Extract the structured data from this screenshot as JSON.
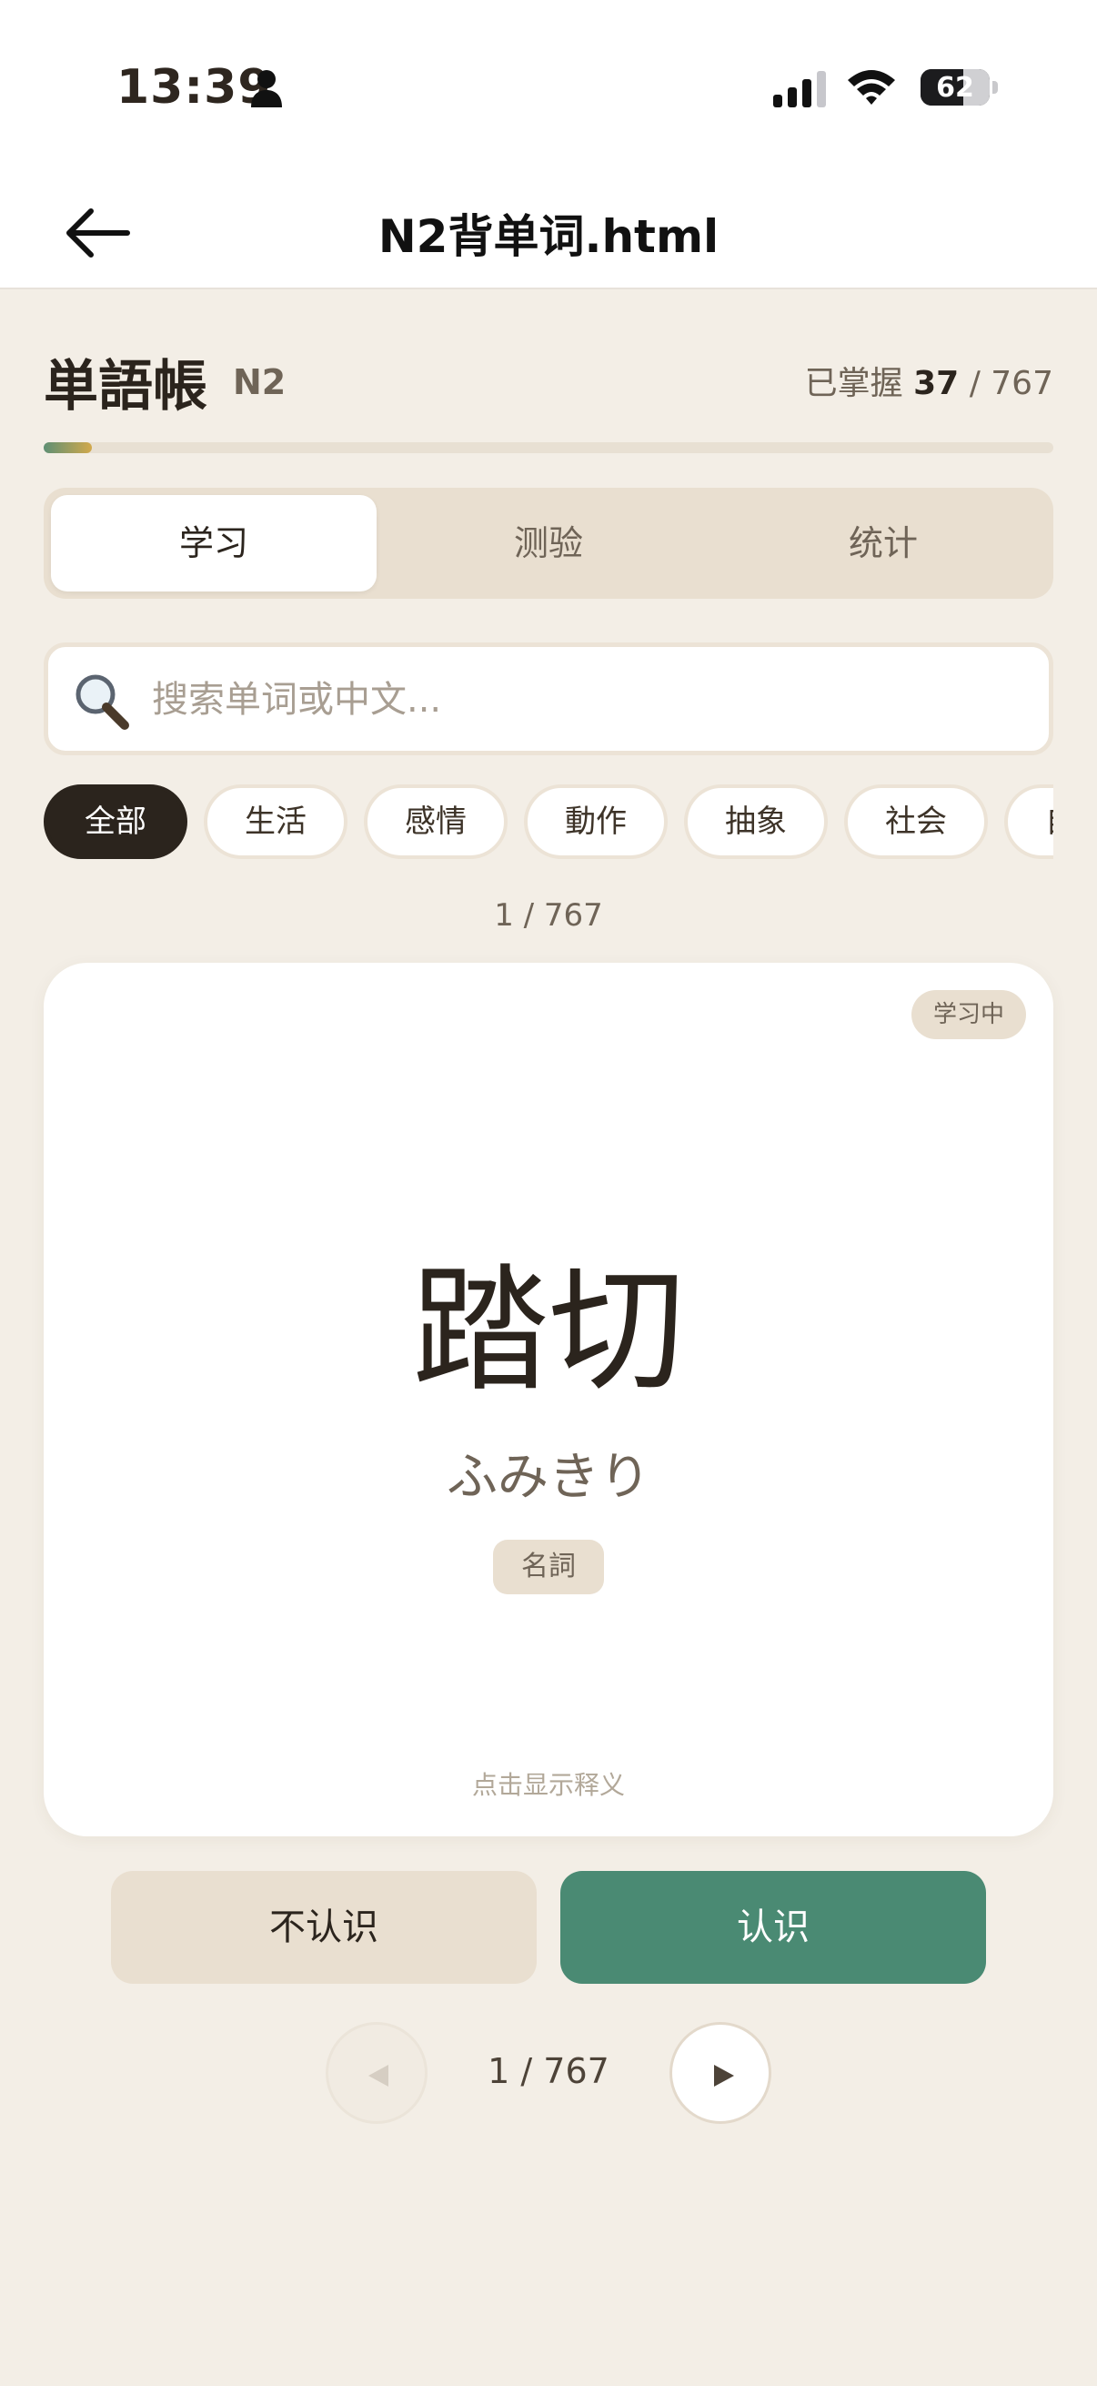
{
  "status_bar": {
    "time": "13:39",
    "battery": "62",
    "battery_level": 0.62
  },
  "nav": {
    "title": "N2背单词.html"
  },
  "header": {
    "title": "単語帳",
    "level": "N2",
    "mastered_label": "已掌握",
    "mastered_count": "37",
    "separator": "/",
    "total": "767",
    "progress": 0.048
  },
  "tabs": [
    {
      "label": "学习",
      "active": true
    },
    {
      "label": "测验",
      "active": false
    },
    {
      "label": "统计",
      "active": false
    }
  ],
  "search": {
    "placeholder": "搜索单词或中文...",
    "value": ""
  },
  "categories": [
    {
      "label": "全部",
      "active": true
    },
    {
      "label": "生活",
      "active": false
    },
    {
      "label": "感情",
      "active": false
    },
    {
      "label": "動作",
      "active": false
    },
    {
      "label": "抽象",
      "active": false
    },
    {
      "label": "社会",
      "active": false
    },
    {
      "label": "自然",
      "active": false
    }
  ],
  "counter": "1 / 767",
  "card": {
    "status": "学习中",
    "word": "踏切",
    "reading": "ふみきり",
    "part_of_speech": "名詞",
    "hint": "点击显示释义"
  },
  "actions": {
    "unknown": "不认识",
    "known": "认识"
  },
  "pager": {
    "count": "1 / 767"
  },
  "colors": {
    "background": "#f3eee6",
    "accent_green": "#4a8a73",
    "chip_active": "#2b241d",
    "tan": "#e9dfd0"
  }
}
